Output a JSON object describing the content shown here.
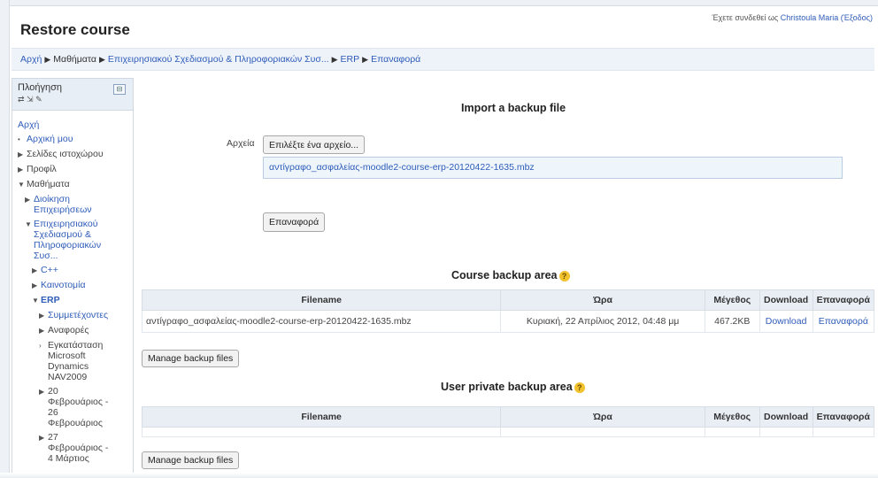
{
  "page": {
    "title": "Restore course",
    "login_text": "Έχετε συνδεθεί ως",
    "login_user": "Christoula Maria (Έξοδος)"
  },
  "breadcrumb": [
    "Αρχή",
    "Μαθήματα",
    "Επιχειρησιακού Σχεδιασμού & Πληροφοριακών Συσ...",
    "ERP",
    "Επαναφορά"
  ],
  "nav": {
    "title": "Πλοήγηση",
    "tools": "⇄ ⇲ ✎",
    "dock_icon": "dock-icon",
    "items": [
      {
        "label": "Αρχή",
        "link": true
      },
      {
        "label": "Αρχική μου",
        "link": true
      },
      {
        "label": "Σελίδες ιστοχώρου",
        "link": false
      },
      {
        "label": "Προφίλ",
        "link": false
      },
      {
        "label": "Μαθήματα",
        "link": false
      },
      {
        "label": "Διοίκηση Επιχειρήσεων",
        "link": true
      },
      {
        "label": "Επιχειρησιακού Σχεδιασμού & Πληροφοριακών Συσ...",
        "link": true
      },
      {
        "label": "C++",
        "link": true
      },
      {
        "label": "Καινοτομία",
        "link": true
      },
      {
        "label": "ERP",
        "link": true
      },
      {
        "label": "Συμμετέχοντες",
        "link": true
      },
      {
        "label": "Αναφορές",
        "link": false
      },
      {
        "label": "Εγκατάσταση Microsoft Dynamics NAV2009",
        "link": false
      },
      {
        "label": "20 Φεβρουάριος - 26 Φεβρουάριος",
        "link": false
      },
      {
        "label": "27 Φεβρουάριος - 4 Μάρτιος",
        "link": false
      }
    ]
  },
  "import": {
    "heading": "Import a backup file",
    "file_label": "Αρχεία",
    "choose_button": "Επιλέξτε ένα αρχείο...",
    "selected_file": "αντίγραφο_ασφαλείας-moodle2-course-erp-20120422-1635.mbz",
    "restore_button": "Επαναφορά"
  },
  "course_backup": {
    "heading": "Course backup area",
    "columns": [
      "Filename",
      "Ώρα",
      "Μέγεθος",
      "Download",
      "Επαναφορά"
    ],
    "rows": [
      {
        "filename": "αντίγραφο_ασφαλείας-moodle2-course-erp-20120422-1635.mbz",
        "time": "Κυριακή, 22 Απρίλιος 2012, 04:48 μμ",
        "size": "467.2KB",
        "download": "Download",
        "restore": "Επαναφορά"
      }
    ],
    "manage_button": "Manage backup files"
  },
  "user_backup": {
    "heading": "User private backup area",
    "columns": [
      "Filename",
      "Ώρα",
      "Μέγεθος",
      "Download",
      "Επαναφορά"
    ],
    "manage_button": "Manage backup files"
  }
}
